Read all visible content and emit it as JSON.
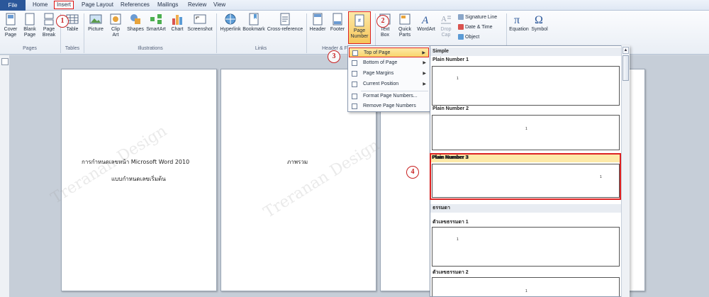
{
  "ribbon_tabs": [
    "File",
    "Home",
    "Insert",
    "Page Layout",
    "References",
    "Mailings",
    "Review",
    "View"
  ],
  "ribbon": {
    "pages": {
      "cover_page": "Cover Page",
      "blank_page": "Blank Page",
      "page_break": "Page Break",
      "label": "Pages"
    },
    "tables": {
      "table": "Table",
      "label": "Tables"
    },
    "illustrations": {
      "picture": "Picture",
      "clip_art": "Clip Art",
      "shapes": "Shapes",
      "smartart": "SmartArt",
      "chart": "Chart",
      "screenshot": "Screenshot",
      "label": "Illustrations"
    },
    "links": {
      "hyperlink": "Hyperlink",
      "bookmark": "Bookmark",
      "cross_reference": "Cross-reference",
      "label": "Links"
    },
    "header_footer": {
      "header": "Header",
      "footer": "Footer",
      "page_number": "Page Number",
      "label": "Header & Footer"
    },
    "text": {
      "text_box": "Text Box",
      "quick_parts": "Quick Parts",
      "wordart": "WordArt",
      "drop_cap": "Drop Cap",
      "signature_line": "Signature Line",
      "date_time": "Date & Time",
      "object": "Object"
    },
    "symbols": {
      "equation": "Equation",
      "symbol": "Symbol"
    }
  },
  "badges": [
    "1",
    "2",
    "3",
    "4"
  ],
  "pages": {
    "page1_line1": "การกำหนดเลขหน้า Microsoft Word 2010",
    "page1_line2": "แบบกำหนดเลขเริ่มต้น",
    "page2_text": "ภาพรวม"
  },
  "page_number_menu": {
    "items": [
      "Top of Page",
      "Bottom of Page",
      "Page Margins",
      "Current Position",
      "Format Page Numbers...",
      "Remove Page Numbers"
    ],
    "active": "Top of Page"
  },
  "gallery": {
    "section1": "Simple",
    "items": [
      "Plain Number 1",
      "Plain Number 2",
      "Plain Number 3"
    ],
    "section2": "ธรรมดา",
    "items2": [
      "ตัวเลขธรรมดา 1",
      "ตัวเลขธรรมดา 2"
    ],
    "thumb_number": "1"
  },
  "watermark": "Treranan Design"
}
